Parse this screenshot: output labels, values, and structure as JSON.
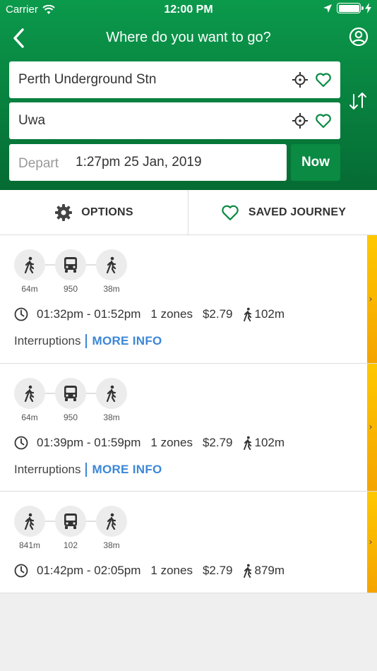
{
  "status": {
    "carrier": "Carrier",
    "time": "12:00 PM",
    "battery_level": 1.0
  },
  "nav": {
    "title": "Where do you want to go?",
    "back_icon": "chevron-left-icon",
    "profile_icon": "user-circle-icon"
  },
  "from": {
    "value": "Perth Underground Stn"
  },
  "to": {
    "value": "Uwa"
  },
  "depart": {
    "label": "Depart",
    "value": "1:27pm 25 Jan, 2019",
    "now_label": "Now"
  },
  "tabs": {
    "options": "OPTIONS",
    "saved": "SAVED JOURNEY"
  },
  "colors": {
    "brand_green": "#0a8a43",
    "accent_yellow": "#f5a400",
    "link_blue": "#3b87d8"
  },
  "journeys": [
    {
      "legs": [
        {
          "mode": "walk",
          "label": "64m"
        },
        {
          "mode": "bus",
          "label": "950"
        },
        {
          "mode": "walk",
          "label": "38m"
        }
      ],
      "time": "01:32pm - 01:52pm",
      "zones": "1 zones",
      "fare": "$2.79",
      "walk": "102m",
      "interruptions": "Interruptions",
      "more_info": "MORE INFO"
    },
    {
      "legs": [
        {
          "mode": "walk",
          "label": "64m"
        },
        {
          "mode": "bus",
          "label": "950"
        },
        {
          "mode": "walk",
          "label": "38m"
        }
      ],
      "time": "01:39pm - 01:59pm",
      "zones": "1 zones",
      "fare": "$2.79",
      "walk": "102m",
      "interruptions": "Interruptions",
      "more_info": "MORE INFO"
    },
    {
      "legs": [
        {
          "mode": "walk",
          "label": "841m"
        },
        {
          "mode": "bus",
          "label": "102"
        },
        {
          "mode": "walk",
          "label": "38m"
        }
      ],
      "time": "01:42pm - 02:05pm",
      "zones": "1 zones",
      "fare": "$2.79",
      "walk": "879m"
    }
  ]
}
